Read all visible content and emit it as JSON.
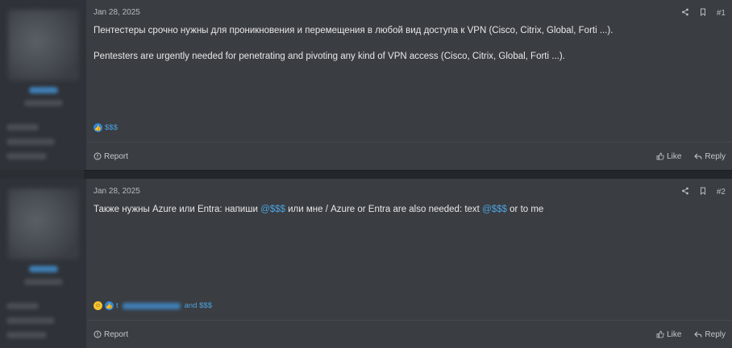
{
  "posts": [
    {
      "date": "Jan 28, 2025",
      "number": "#1",
      "paragraphs": [
        "Пентестеры срочно нужны для проникновения и перемещения в любой вид доступа к VPN (Cisco, Citrix, Global, Forti ...).",
        "Pentesters are urgently needed for penetrating and pivoting any kind of VPN access (Cisco, Citrix, Global, Forti ...)."
      ],
      "reactions_text": "$$$",
      "report_label": "Report",
      "like_label": "Like",
      "reply_label": "Reply"
    },
    {
      "date": "Jan 28, 2025",
      "number": "#2",
      "text_before": "Также нужны Azure или Entra: напиши ",
      "mention1": "@$$$",
      "text_middle": " или мне / Azure or Entra are also needed: text ",
      "mention2": "@$$$",
      "text_after": " or to me",
      "reactions_prefix": "t",
      "reactions_suffix": "and $$$",
      "report_label": "Report",
      "like_label": "Like",
      "reply_label": "Reply"
    }
  ],
  "colors": {
    "accent": "#4ca3e0",
    "post_bg": "#3a3d42",
    "sidebar_bg": "#2f3339"
  }
}
